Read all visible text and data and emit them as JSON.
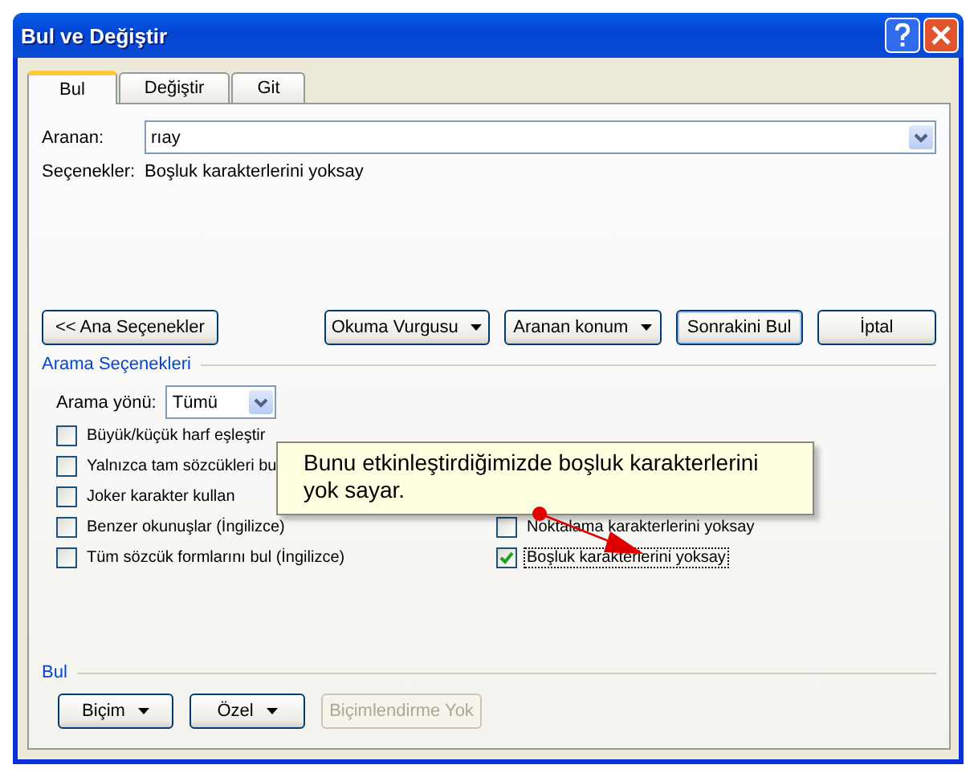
{
  "window": {
    "title": "Bul ve Değiştir"
  },
  "tabs": [
    {
      "label": "Bul",
      "selected": true
    },
    {
      "label": "Değiştir",
      "selected": false
    },
    {
      "label": "Git",
      "selected": false
    }
  ],
  "search": {
    "label": "Aranan:",
    "value": "rıay"
  },
  "options_summary": {
    "label": "Seçenekler:",
    "value": "Boşluk karakterlerini yoksay"
  },
  "buttons": [
    {
      "label": "<< Ana Seçenekler",
      "kind": "plain"
    },
    {
      "label": "Okuma Vurgusu",
      "kind": "menu"
    },
    {
      "label": "Aranan konum",
      "kind": "menu"
    },
    {
      "label": "Sonrakini Bul",
      "kind": "default"
    },
    {
      "label": "İptal",
      "kind": "plain"
    }
  ],
  "search_options": {
    "title": "Arama Seçenekleri",
    "direction": {
      "label": "Arama yönü:",
      "value": "Tümü"
    },
    "left_checks": [
      {
        "label": "Büyük/küçük harf eşleştir",
        "checked": false,
        "focused": false
      },
      {
        "label": "Yalnızca tam sözcükleri bu",
        "checked": false,
        "focused": false
      },
      {
        "label": "Joker karakter kullan",
        "checked": false,
        "focused": false
      },
      {
        "label": "Benzer okunuşlar (İngilizce)",
        "checked": false,
        "focused": false
      },
      {
        "label": "Tüm sözcük formlarını bul (İngilizce)",
        "checked": false,
        "focused": false
      }
    ],
    "right_checks": [
      {
        "label": "Noktalama karakterlerini yoksay",
        "checked": false,
        "focused": false
      },
      {
        "label": "Boşluk karakterlerini yoksay",
        "checked": true,
        "focused": true
      }
    ]
  },
  "find_section": {
    "title": "Bul",
    "buttons": [
      {
        "label": "Biçim",
        "kind": "menu",
        "disabled": false
      },
      {
        "label": "Özel",
        "kind": "menu",
        "disabled": false
      },
      {
        "label": "Biçimlendirme Yok",
        "kind": "plain",
        "disabled": true
      }
    ]
  },
  "callout": {
    "text": "Bunu etkinleştirdiğimizde boşluk karakterlerini yok sayar."
  }
}
